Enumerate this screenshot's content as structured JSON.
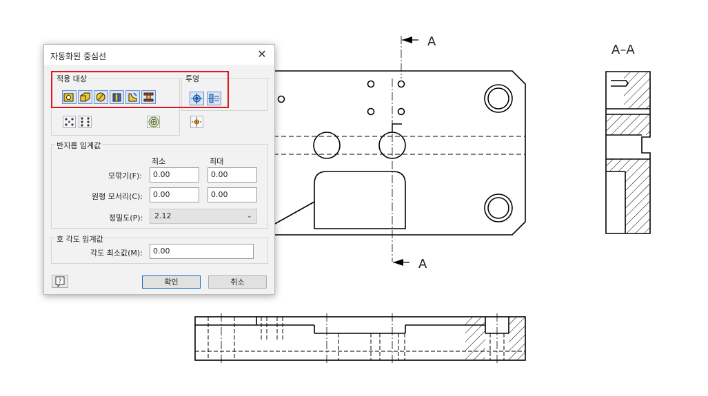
{
  "dialog": {
    "title": "자동화된 중심선",
    "close_glyph": "✕",
    "apply_to": {
      "label": "적용 대상",
      "tools": [
        "hole-feature",
        "fillet-feature",
        "cylindrical-feature",
        "revolved-feature",
        "work-feature",
        "punch-feature"
      ],
      "pattern_tools": [
        "circular-pattern",
        "rectangular-pattern"
      ],
      "bolt_circle_tool": "bolt-circle"
    },
    "projection": {
      "label": "투영",
      "tools": [
        "axis-normal",
        "axis-parallel"
      ],
      "extra_tool": "center-mark"
    },
    "radius_threshold": {
      "label": "반지름 임계값",
      "min_header": "최소",
      "max_header": "최대",
      "fillet_label": "모깎기(F):",
      "fillet_min": "0.00",
      "fillet_max": "0.00",
      "circular_edge_label": "원형 모서리(C):",
      "circular_edge_min": "0.00",
      "circular_edge_max": "0.00",
      "precision_label": "정밀도(P):",
      "precision_value": "2.12"
    },
    "arc_angle_threshold": {
      "label": "호 각도 임계값",
      "min_angle_label": "각도 최소값(M):",
      "min_angle_value": "0.00"
    },
    "help_label": "?",
    "ok_label": "확인",
    "cancel_label": "취소"
  },
  "drawing": {
    "section_marker_top": "A",
    "section_marker_bottom": "A",
    "section_view_title": "A–A"
  },
  "colors": {
    "highlight": "#e0141e",
    "tool_active_bg": "#d8e6f6",
    "tool_active_border": "#6a8fc4",
    "primary_border": "#0a64c8"
  }
}
